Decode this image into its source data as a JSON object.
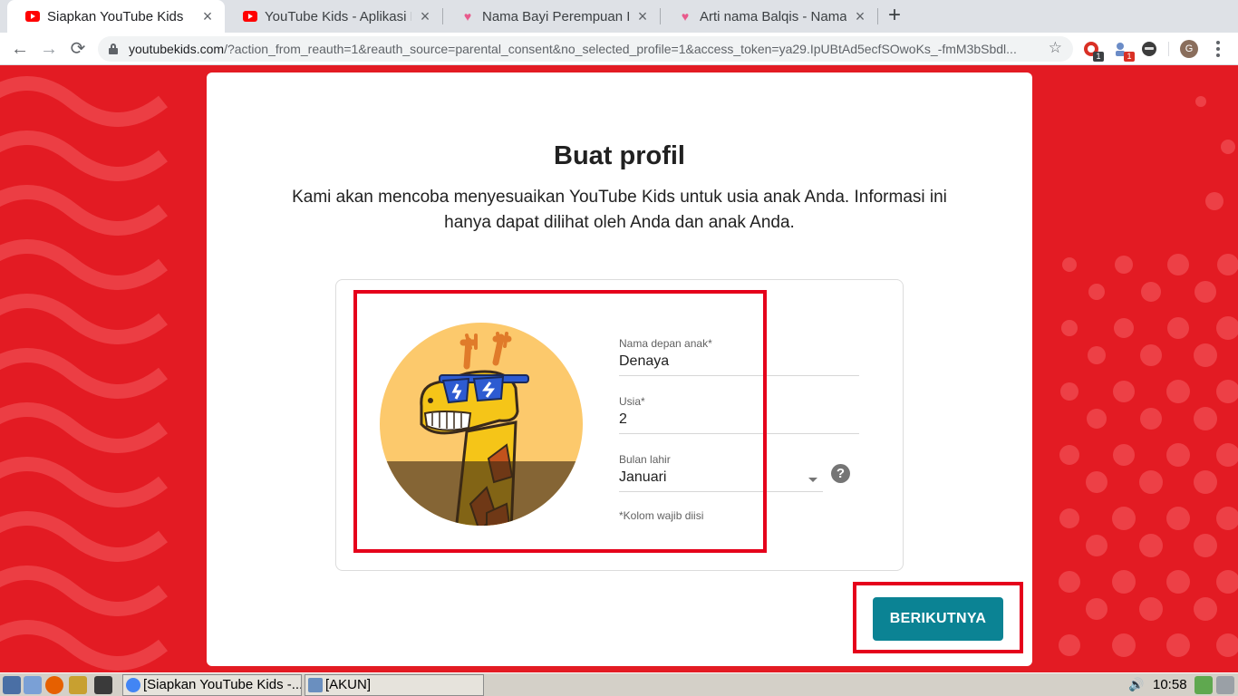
{
  "browser": {
    "tabs": [
      {
        "title": "Siapkan YouTube Kids",
        "favicon": "youtube-icon",
        "active": true
      },
      {
        "title": "YouTube Kids - Aplikasi Kh",
        "favicon": "youtube-icon",
        "active": false
      },
      {
        "title": "Nama Bayi Perempuan Isl",
        "favicon": "heart-icon",
        "active": false
      },
      {
        "title": "Arti nama Balqis - Nama B",
        "favicon": "heart-icon",
        "active": false
      }
    ],
    "url_host": "youtubekids.com",
    "url_rest": "/?action_from_reauth=1&reauth_source=parental_consent&no_selected_profile=1&access_token=ya29.IpUBtAd5ecfSOwoKs_-fmM3bSbdl...",
    "extensions": [
      {
        "name": "extension-red-icon",
        "badge": "1"
      },
      {
        "name": "extension-blue-icon",
        "badge": "1"
      },
      {
        "name": "extension-dark-icon",
        "badge": ""
      }
    ],
    "profile_initial": "G"
  },
  "card": {
    "title": "Buat profil",
    "subtitle": "Kami akan mencoba menyesuaikan YouTube Kids untuk usia anak Anda. Informasi ini hanya dapat dilihat oleh Anda dan anak Anda."
  },
  "form": {
    "name_label": "Nama depan anak*",
    "name_value": "Denaya",
    "age_label": "Usia*",
    "age_value": "2",
    "month_label": "Bulan lahir",
    "month_value": "Januari",
    "required_note": "*Kolom wajib diisi",
    "help_glyph": "?"
  },
  "next_button": "BERIKUTNYA",
  "taskbar": {
    "windows": [
      {
        "title": "[Siapkan YouTube Kids -...",
        "icon": "chrome-icon"
      },
      {
        "title": "[AKUN]",
        "icon": "folder-icon"
      }
    ],
    "clock": "10:58"
  },
  "colors": {
    "page_red": "#e31b23",
    "button_teal": "#0b8394",
    "highlight_red": "#e5001b"
  }
}
